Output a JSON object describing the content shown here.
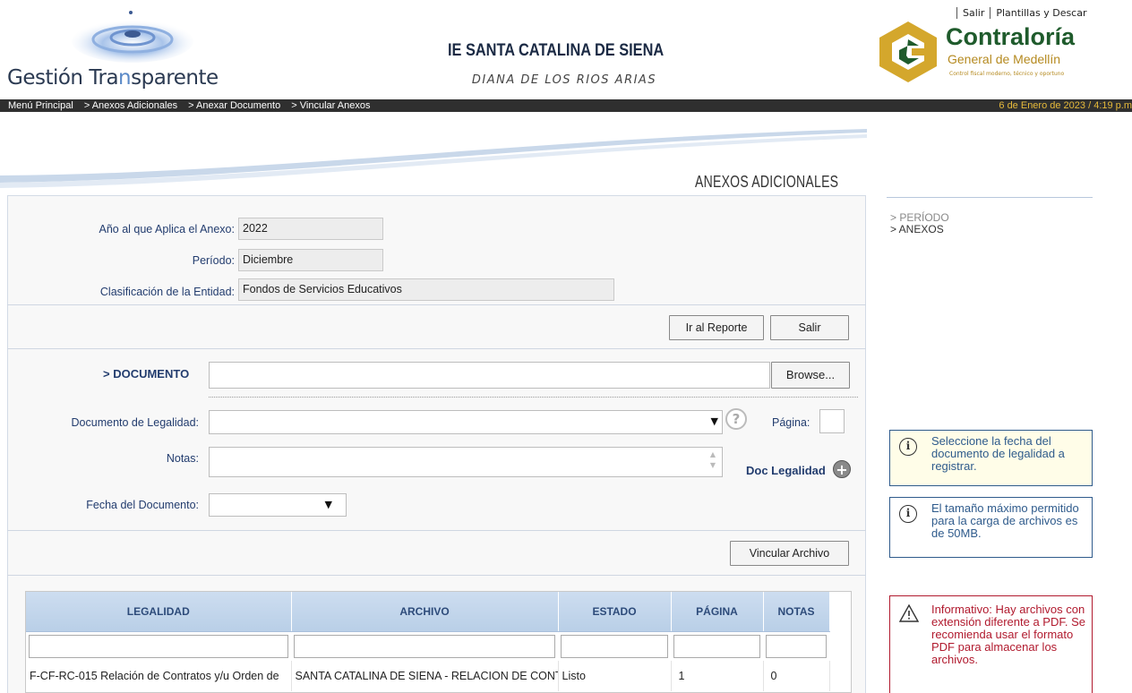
{
  "header": {
    "brand_prefix": "Gestión Tra",
    "brand_hl": "n",
    "brand_suffix": "sparente",
    "institution": "IE SANTA CATALINA DE SIENA",
    "person": "DIANA DE LOS RIOS ARIAS",
    "links": {
      "exit": "Salir",
      "templates": "Plantillas y Descar"
    },
    "contraloria": {
      "title": "Contraloría",
      "subtitle": "General de Medellín",
      "tagline": "Control fiscal moderno, técnico y oportuno"
    }
  },
  "navbar": {
    "breadcrumbs": [
      "Menú Principal",
      "> Anexos Adicionales",
      "> Anexar Documento",
      "> Vincular Anexos"
    ],
    "date": "6 de Enero de 2023 / 4:19 p.m"
  },
  "panel": {
    "title": "ANEXOS ADICIONALES",
    "info": [
      {
        "label": "Año al que Aplica el Anexo:",
        "value": "2022"
      },
      {
        "label": "Período:",
        "value": "Diciembre"
      },
      {
        "label": "Clasificación de la Entidad:",
        "value": "Fondos de Servicios Educativos"
      }
    ],
    "buttons": {
      "report": "Ir al Reporte",
      "exit": "Salir",
      "browse": "Browse...",
      "link_file": "Vincular Archivo"
    },
    "form": {
      "document_label": "> DOCUMENTO",
      "document_value": "",
      "legality_label": "Documento de Legalidad:",
      "legality_value": "",
      "page_label": "Página:",
      "page_value": "",
      "notes_label": "Notas:",
      "notes_value": "",
      "doc_legal_label": "Doc Legalidad",
      "date_label": "Fecha del Documento:",
      "date_value": ""
    }
  },
  "grid": {
    "columns": [
      "LEGALIDAD",
      "ARCHIVO",
      "ESTADO",
      "PÁGINA",
      "NOTAS"
    ],
    "rows": [
      {
        "legalidad": "F-CF-RC-015 Relación de Contratos y/u Orden de",
        "archivo": "SANTA CATALINA DE SIENA - RELACION DE CONTRATOS",
        "estado": "Listo",
        "pagina": "1",
        "notas": "0"
      }
    ]
  },
  "sidebar": {
    "nav": [
      "> PERÍODO",
      "> ANEXOS"
    ],
    "info1": "Seleccione la fecha del documento de legalidad a registrar.",
    "info2": "El tamaño máximo permitido para la carga de archivos es de 50MB.",
    "warning": "Informativo: Hay archivos con extensión diferente a PDF. Se recomienda usar el formato PDF para almacenar los archivos."
  },
  "icons": {
    "help": "help-icon",
    "add": "plus-circle-icon",
    "info": "info-icon",
    "warning": "warning-triangle-icon"
  },
  "colors": {
    "navbar": "#2f2f2f",
    "date": "#e5b93a",
    "label": "#223c6e",
    "info_border": "#2f5b8c",
    "warning": "#b11a2e",
    "brand_green": "#1f5b2c",
    "brand_gold": "#b58a20"
  }
}
